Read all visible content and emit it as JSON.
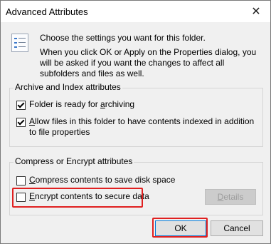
{
  "window": {
    "title": "Advanced Attributes",
    "close_symbol": "✕"
  },
  "intro": {
    "icon": "settings-list-icon",
    "line1": "Choose the settings you want for this folder.",
    "line2": "When you click OK or Apply on the Properties dialog, you will be asked if you want the changes to affect all subfolders and files as well."
  },
  "archive_group": {
    "title": "Archive and Index attributes",
    "archiving": {
      "prefix": "Folder is ready for ",
      "underlined": "a",
      "suffix": "rchiving",
      "checked": true
    },
    "indexing": {
      "prefix": "",
      "underlined": "A",
      "suffix": "llow files in this folder to have contents indexed in addition to file properties",
      "checked": true
    }
  },
  "encrypt_group": {
    "title": "Compress or Encrypt attributes",
    "compress": {
      "prefix": "",
      "underlined": "C",
      "suffix": "ompress contents to save disk space",
      "checked": false
    },
    "encrypt": {
      "prefix": "",
      "underlined": "E",
      "suffix": "ncrypt contents to secure data",
      "checked": false
    },
    "details_label": "Details"
  },
  "buttons": {
    "ok": "OK",
    "cancel": "Cancel"
  },
  "colors": {
    "highlight": "#e02020",
    "focus": "#0078d7"
  }
}
